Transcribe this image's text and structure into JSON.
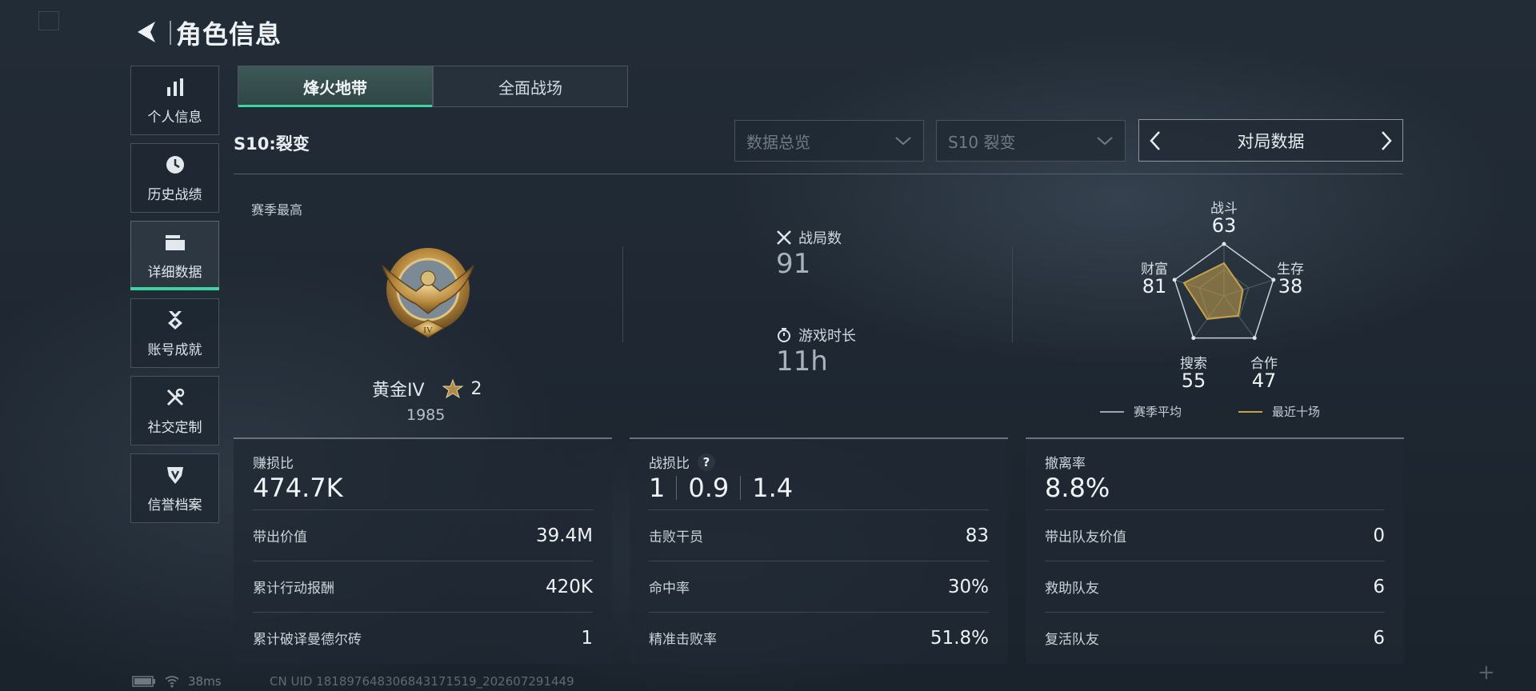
{
  "header": {
    "title": "角色信息"
  },
  "sidebar": {
    "items": [
      {
        "label": "个人信息",
        "icon": "bar-chart-icon"
      },
      {
        "label": "历史战绩",
        "icon": "clock-icon"
      },
      {
        "label": "详细数据",
        "icon": "folder-icon",
        "active": true
      },
      {
        "label": "账号成就",
        "icon": "medal-icon"
      },
      {
        "label": "社交定制",
        "icon": "tools-icon"
      },
      {
        "label": "信誉档案",
        "icon": "shield-icon"
      }
    ]
  },
  "tabs": [
    {
      "label": "烽火地带",
      "active": true
    },
    {
      "label": "全面战场",
      "active": false
    }
  ],
  "season": {
    "label": "S10:裂变"
  },
  "filters": {
    "overview": "数据总览",
    "season": "S10 裂变",
    "match_label": "对局数据"
  },
  "rank": {
    "section_title": "赛季最高",
    "name": "黄金IV",
    "stars": "2",
    "score": "1985"
  },
  "summary": {
    "matches_label": "战局数",
    "matches_value": "91",
    "playtime_label": "游戏时长",
    "playtime_value": "11h"
  },
  "radar": {
    "axes": [
      {
        "label": "战斗",
        "value": "63"
      },
      {
        "label": "生存",
        "value": "38"
      },
      {
        "label": "合作",
        "value": "47"
      },
      {
        "label": "搜索",
        "value": "55"
      },
      {
        "label": "财富",
        "value": "81"
      }
    ],
    "legend_season": "赛季平均",
    "legend_recent": "最近十场",
    "season_color": "#9aa6b2",
    "recent_color": "#c8a24a"
  },
  "panels": {
    "profit": {
      "title": "赚损比",
      "value": "474.7K",
      "rows": [
        {
          "label": "带出价值",
          "value": "39.4M"
        },
        {
          "label": "累计行动报酬",
          "value": "420K"
        },
        {
          "label": "累计破译曼德尔砖",
          "value": "1"
        }
      ]
    },
    "combat": {
      "title": "战损比",
      "help": "?",
      "values": [
        "1",
        "0.9",
        "1.4"
      ],
      "rows": [
        {
          "label": "击败干员",
          "value": "83"
        },
        {
          "label": "命中率",
          "value": "30%"
        },
        {
          "label": "精准击败率",
          "value": "51.8%"
        }
      ]
    },
    "extract": {
      "title": "撤离率",
      "value": "8.8%",
      "rows": [
        {
          "label": "带出队友价值",
          "value": "0"
        },
        {
          "label": "救助队友",
          "value": "6"
        },
        {
          "label": "复活队友",
          "value": "6"
        }
      ]
    }
  },
  "footer": {
    "ping": "38ms",
    "uid": "CN UID 18189764830684317151​9_202607291449"
  }
}
